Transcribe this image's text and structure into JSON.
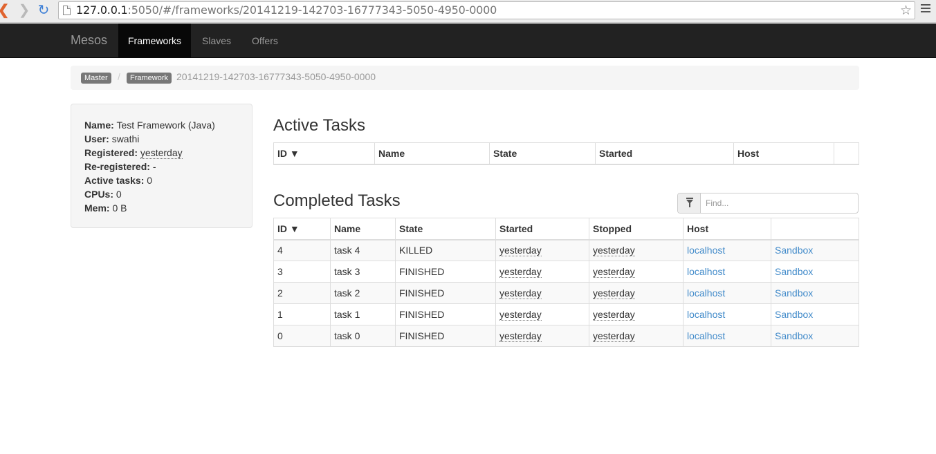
{
  "browser": {
    "url_host": "127.0.0.1",
    "url_rest": ":5050/#/frameworks/20141219-142703-16777343-5050-4950-0000"
  },
  "navbar": {
    "brand": "Mesos",
    "links": [
      {
        "label": "Frameworks",
        "active": true
      },
      {
        "label": "Slaves",
        "active": false
      },
      {
        "label": "Offers",
        "active": false
      }
    ]
  },
  "breadcrumb": {
    "master_label": "Master",
    "separator": "/",
    "framework_label": "Framework",
    "framework_id": "20141219-142703-16777343-5050-4950-0000"
  },
  "info": {
    "name_label": "Name:",
    "name": "Test Framework (Java)",
    "user_label": "User:",
    "user": "swathi",
    "registered_label": "Registered:",
    "registered": "yesterday",
    "reregistered_label": "Re-registered:",
    "reregistered": "-",
    "active_tasks_label": "Active tasks:",
    "active_tasks": "0",
    "cpus_label": "CPUs:",
    "cpus": "0",
    "mem_label": "Mem:",
    "mem": "0 B"
  },
  "active_tasks": {
    "title": "Active Tasks",
    "columns": [
      "ID ▼",
      "Name",
      "State",
      "Started",
      "Host",
      ""
    ]
  },
  "completed_tasks": {
    "title": "Completed Tasks",
    "filter_placeholder": "Find...",
    "columns": [
      "ID ▼",
      "Name",
      "State",
      "Started",
      "Stopped",
      "Host",
      ""
    ],
    "rows": [
      {
        "id": "4",
        "name": "task 4",
        "state": "KILLED",
        "started": "yesterday",
        "stopped": "yesterday",
        "host": "localhost",
        "sandbox": "Sandbox"
      },
      {
        "id": "3",
        "name": "task 3",
        "state": "FINISHED",
        "started": "yesterday",
        "stopped": "yesterday",
        "host": "localhost",
        "sandbox": "Sandbox"
      },
      {
        "id": "2",
        "name": "task 2",
        "state": "FINISHED",
        "started": "yesterday",
        "stopped": "yesterday",
        "host": "localhost",
        "sandbox": "Sandbox"
      },
      {
        "id": "1",
        "name": "task 1",
        "state": "FINISHED",
        "started": "yesterday",
        "stopped": "yesterday",
        "host": "localhost",
        "sandbox": "Sandbox"
      },
      {
        "id": "0",
        "name": "task 0",
        "state": "FINISHED",
        "started": "yesterday",
        "stopped": "yesterday",
        "host": "localhost",
        "sandbox": "Sandbox"
      }
    ]
  }
}
